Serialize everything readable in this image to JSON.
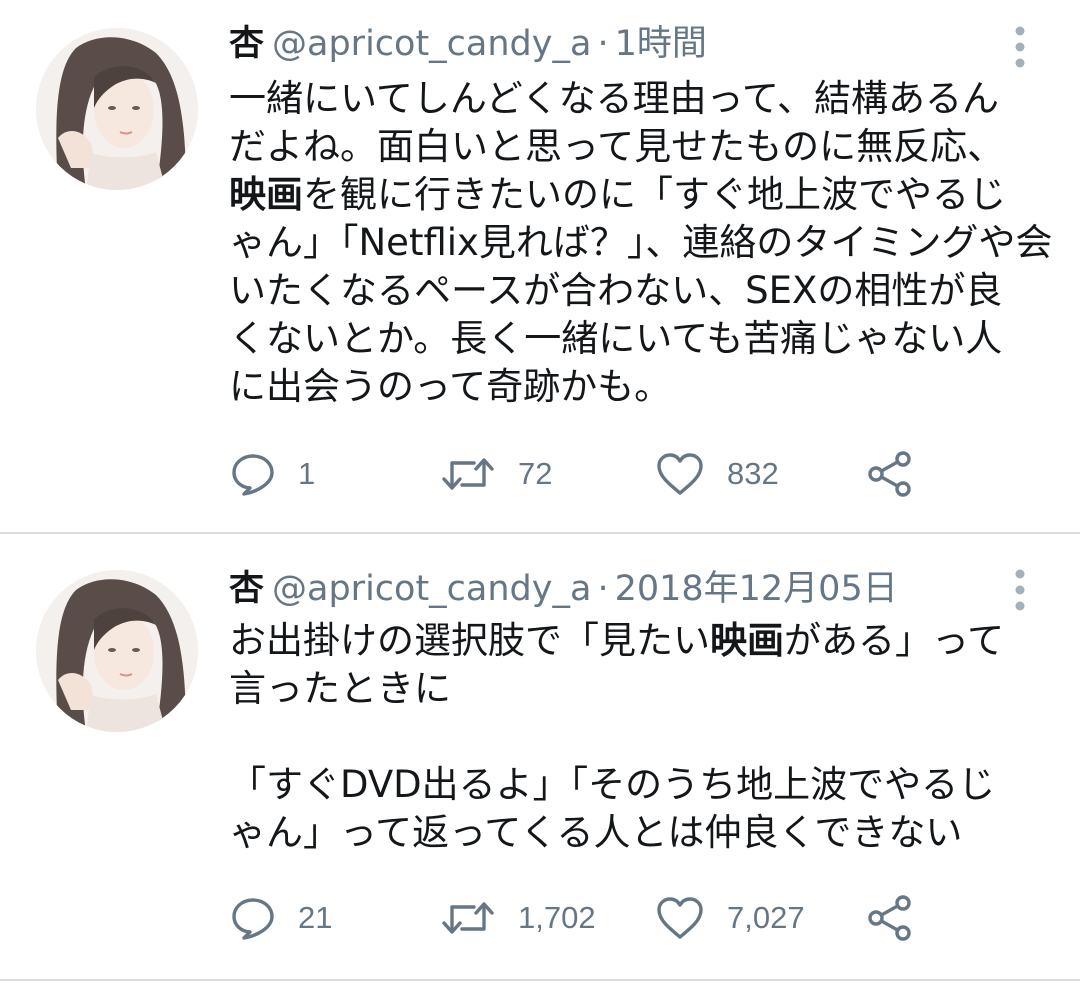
{
  "tweets": [
    {
      "display_name": "杏",
      "handle": "@apricot_candy_a",
      "separator": "·",
      "timestamp": "1時間",
      "body_lines": [
        [
          {
            "t": "一緒にいてしんどくなる理由って、結構あるん"
          }
        ],
        [
          {
            "t": "だよね。面白いと思って見せたものに無反応、"
          }
        ],
        [
          {
            "t": "映画",
            "b": true
          },
          {
            "t": "を観に行きたいのに「すぐ地上波でやるじ"
          }
        ],
        [
          {
            "t": "ゃん」「Netflix見れば？」、連絡のタイミングや会"
          }
        ],
        [
          {
            "t": "いたくなるペースが合わない、SEXの相性が良"
          }
        ],
        [
          {
            "t": "くないとか。長く一緒にいても苦痛じゃない人"
          }
        ],
        [
          {
            "t": "に出会うのって奇跡かも。"
          }
        ]
      ],
      "replies": "1",
      "retweets": "72",
      "likes": "832"
    },
    {
      "display_name": "杏",
      "handle": "@apricot_candy_a",
      "separator": "·",
      "timestamp": "2018年12月05日",
      "body_lines": [
        [
          {
            "t": "お出掛けの選択肢で「見たい"
          },
          {
            "t": "映画",
            "b": true
          },
          {
            "t": "がある」って"
          }
        ],
        [
          {
            "t": "言ったときに"
          }
        ],
        [],
        [
          {
            "t": "「すぐDVD出るよ」「そのうち地上波でやるじ"
          }
        ],
        [
          {
            "t": "ゃん」って返ってくる人とは仲良くできない"
          }
        ]
      ],
      "replies": "21",
      "retweets": "1,702",
      "likes": "7,027"
    }
  ],
  "icons": {
    "reply": "reply-icon",
    "retweet": "retweet-icon",
    "like": "heart-icon",
    "share": "share-icon",
    "more": "more-vertical-icon"
  },
  "colors": {
    "text": "#14171a",
    "secondary": "#657786",
    "divider": "#d7dde2"
  }
}
